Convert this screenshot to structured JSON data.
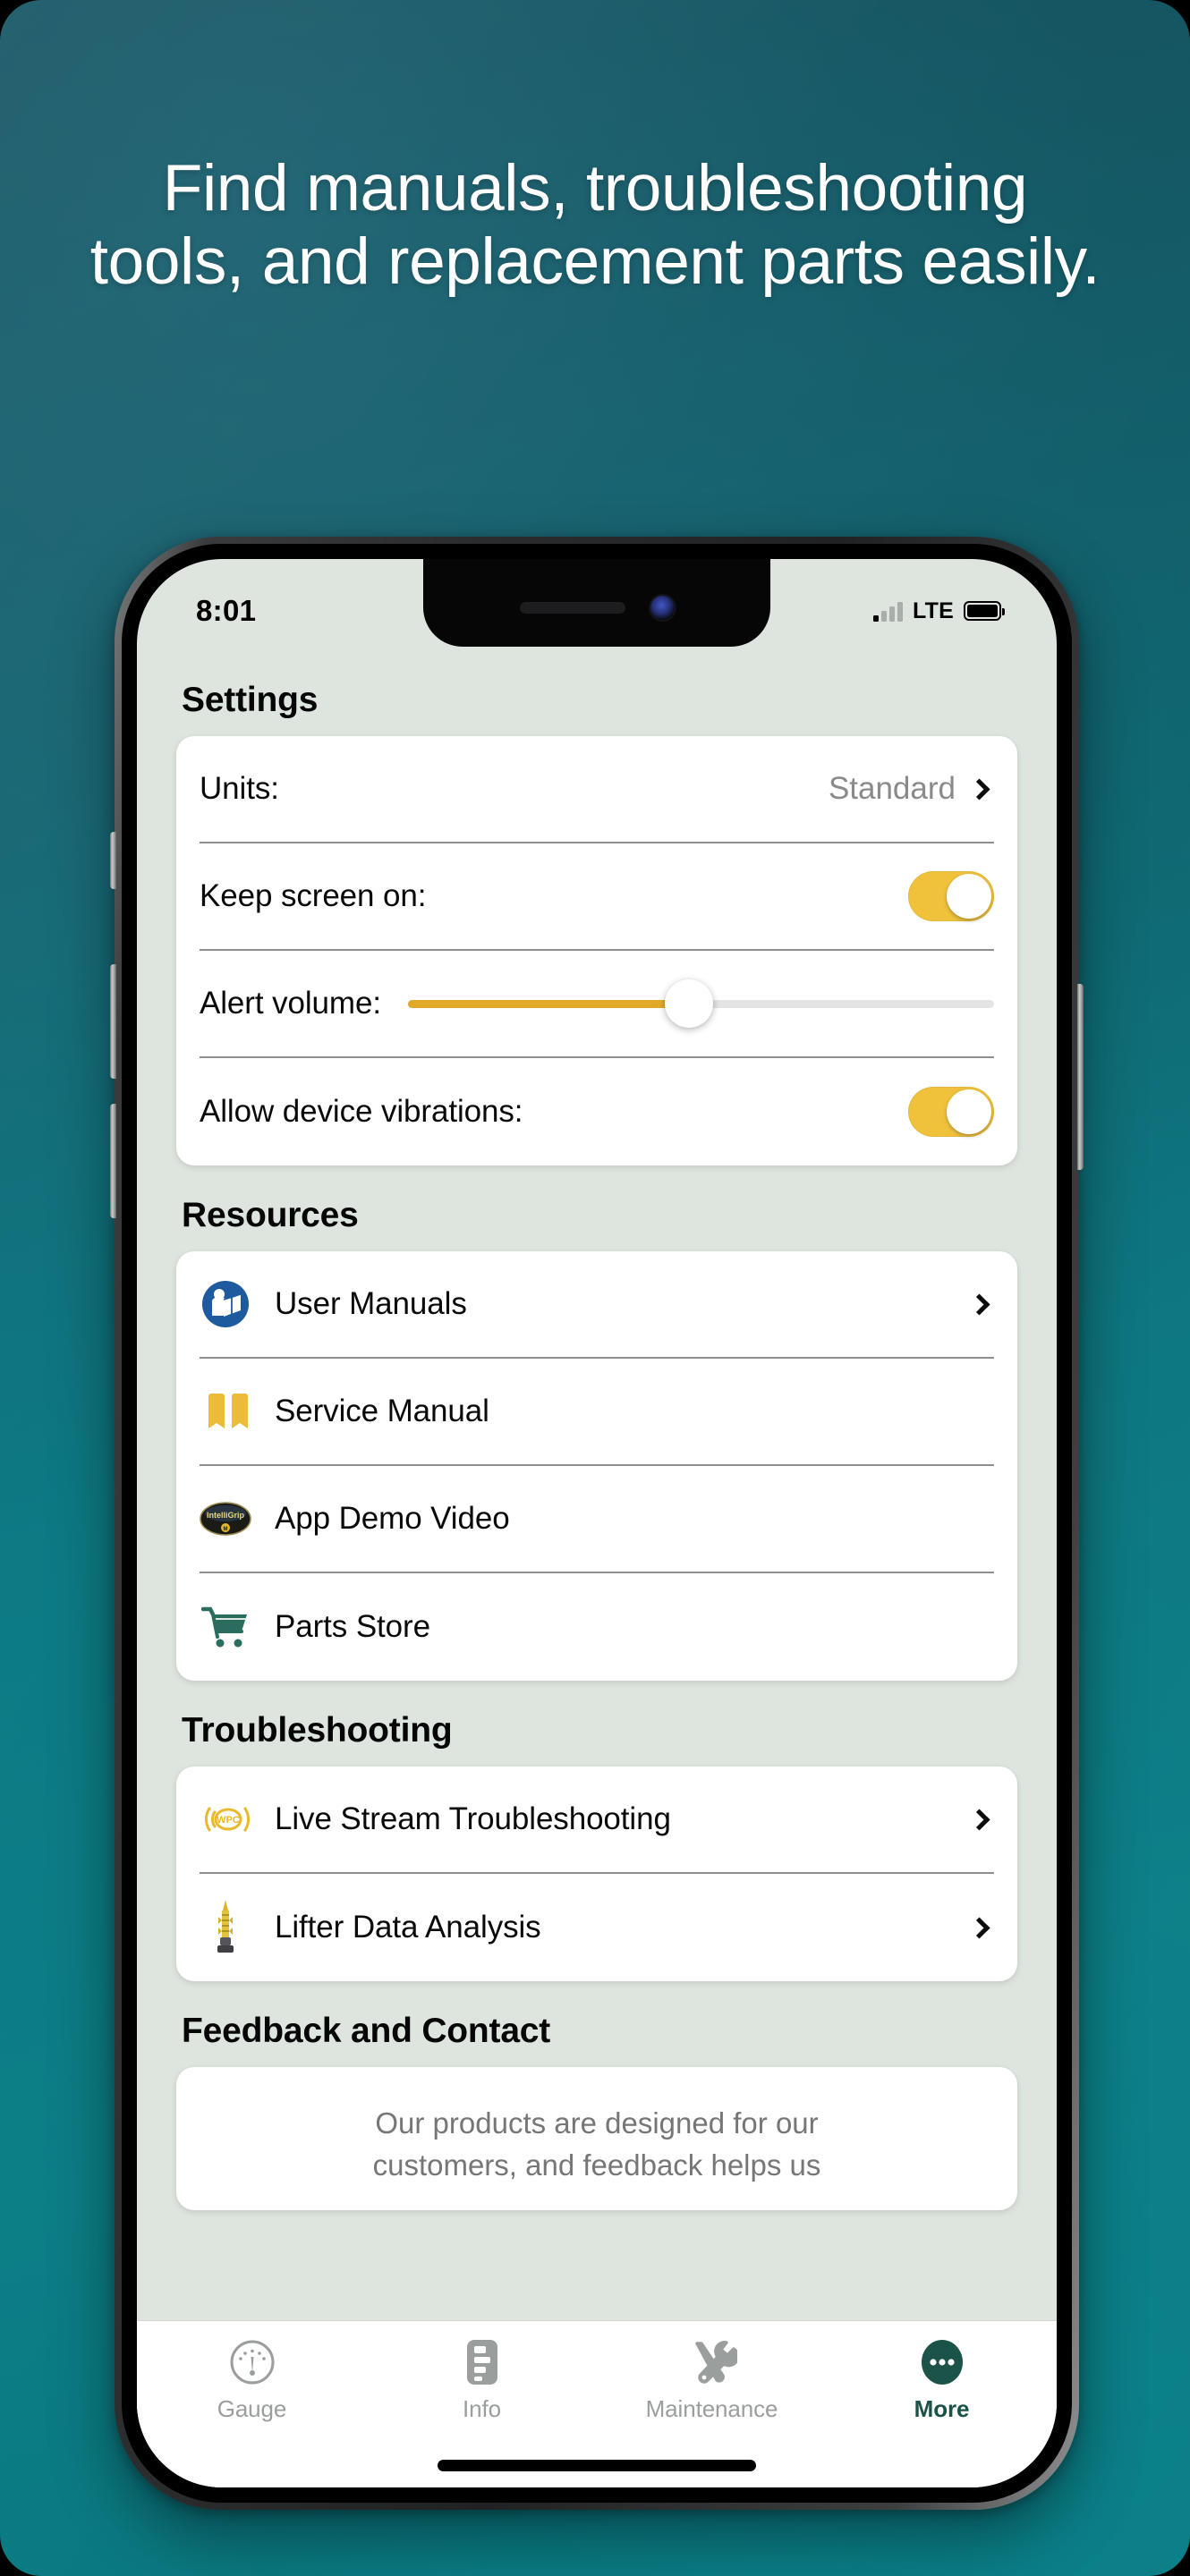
{
  "poster": {
    "headline": "Find manuals, troubleshooting tools, and replacement parts easily.",
    "background_gradient_from": "#17505c",
    "background_gradient_to": "#0a7c85",
    "headline_color": "#ffffff"
  },
  "status_bar": {
    "time": "8:01",
    "network": "LTE",
    "signal_icon": "signal-bars-icon",
    "battery_icon": "battery-full-icon"
  },
  "screen": {
    "background_color": "#dde5de",
    "card_color": "#ffffff",
    "accent_color": "#f0c23c",
    "slider_fill_color": "#e2a929",
    "active_tab_color": "#1c5348"
  },
  "sections": [
    {
      "title": "Settings",
      "rows": [
        {
          "label": "Units:",
          "value": "Standard",
          "control": "chevron"
        },
        {
          "label": "Keep screen on:",
          "control": "toggle",
          "toggle_on": true
        },
        {
          "label": "Alert volume:",
          "control": "slider",
          "slider_percent": 48
        },
        {
          "label": "Allow device vibrations:",
          "control": "toggle",
          "toggle_on": true
        }
      ]
    },
    {
      "title": "Resources",
      "rows": [
        {
          "label": "User Manuals",
          "icon": "read-instructions-icon",
          "control": "chevron"
        },
        {
          "label": "Service Manual",
          "icon": "open-book-icon",
          "control": "none"
        },
        {
          "label": "App Demo Video",
          "icon": "brand-badge-icon",
          "control": "none"
        },
        {
          "label": "Parts Store",
          "icon": "shopping-cart-icon",
          "control": "none"
        }
      ]
    },
    {
      "title": "Troubleshooting",
      "rows": [
        {
          "label": "Live Stream Troubleshooting",
          "icon": "wpc-broadcast-icon",
          "control": "chevron"
        },
        {
          "label": "Lifter Data Analysis",
          "icon": "lifter-tool-icon",
          "control": "chevron"
        }
      ]
    },
    {
      "title": "Feedback and Contact",
      "body_line_1": "Our products are designed for our",
      "body_line_2": "customers, and feedback helps us"
    }
  ],
  "tab_bar": [
    {
      "label": "Gauge",
      "icon": "gauge-icon",
      "active": false
    },
    {
      "label": "Info",
      "icon": "document-icon",
      "active": false
    },
    {
      "label": "Maintenance",
      "icon": "tools-icon",
      "active": false
    },
    {
      "label": "More",
      "icon": "ellipsis-icon",
      "active": true
    }
  ]
}
